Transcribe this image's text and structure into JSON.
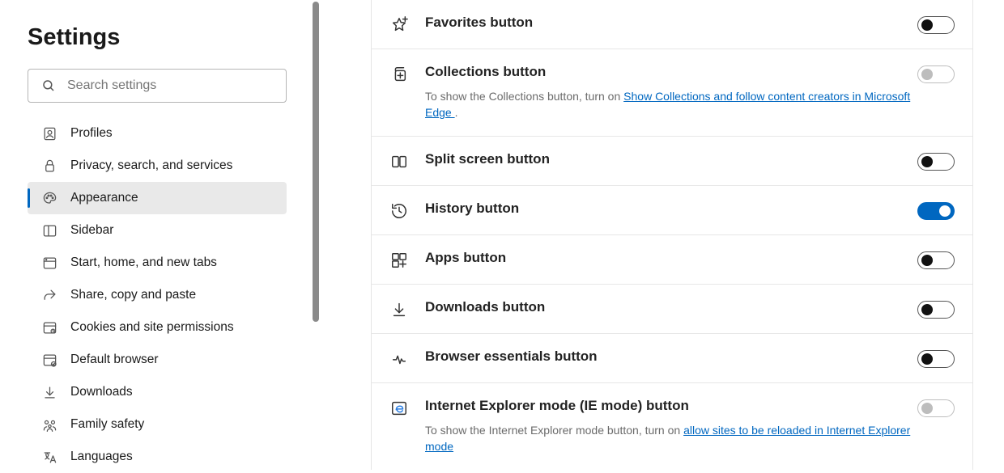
{
  "title": "Settings",
  "search": {
    "placeholder": "Search settings"
  },
  "sidebar": {
    "items": [
      {
        "key": "profiles",
        "label": "Profiles",
        "active": false
      },
      {
        "key": "privacy",
        "label": "Privacy, search, and services",
        "active": false
      },
      {
        "key": "appearance",
        "label": "Appearance",
        "active": true
      },
      {
        "key": "sidebar",
        "label": "Sidebar",
        "active": false
      },
      {
        "key": "start",
        "label": "Start, home, and new tabs",
        "active": false
      },
      {
        "key": "share",
        "label": "Share, copy and paste",
        "active": false
      },
      {
        "key": "cookies",
        "label": "Cookies and site permissions",
        "active": false
      },
      {
        "key": "default",
        "label": "Default browser",
        "active": false
      },
      {
        "key": "downloads",
        "label": "Downloads",
        "active": false
      },
      {
        "key": "family",
        "label": "Family safety",
        "active": false
      },
      {
        "key": "languages",
        "label": "Languages",
        "active": false
      }
    ]
  },
  "rows": [
    {
      "key": "favorites",
      "label": "Favorites button",
      "toggle": {
        "state": "off",
        "enabled": true
      }
    },
    {
      "key": "collections",
      "label": "Collections button",
      "sub_prefix": "To show the Collections button, turn on ",
      "sub_link": "Show Collections and follow content creators in Microsoft Edge ",
      "sub_suffix": ".",
      "toggle": {
        "state": "off",
        "enabled": false
      }
    },
    {
      "key": "splitscreen",
      "label": "Split screen button",
      "toggle": {
        "state": "off",
        "enabled": true
      }
    },
    {
      "key": "history",
      "label": "History button",
      "toggle": {
        "state": "on",
        "enabled": true
      }
    },
    {
      "key": "apps",
      "label": "Apps button",
      "toggle": {
        "state": "off",
        "enabled": true
      }
    },
    {
      "key": "downloads",
      "label": "Downloads button",
      "toggle": {
        "state": "off",
        "enabled": true
      }
    },
    {
      "key": "essentials",
      "label": "Browser essentials button",
      "toggle": {
        "state": "off",
        "enabled": true
      }
    },
    {
      "key": "iemode",
      "label": "Internet Explorer mode (IE mode) button",
      "sub_prefix": "To show the Internet Explorer mode button, turn on ",
      "sub_link": "allow sites to be reloaded in Internet Explorer mode",
      "sub_suffix": "",
      "toggle": {
        "state": "off",
        "enabled": false
      }
    }
  ],
  "colors": {
    "accent": "#0067c0"
  }
}
